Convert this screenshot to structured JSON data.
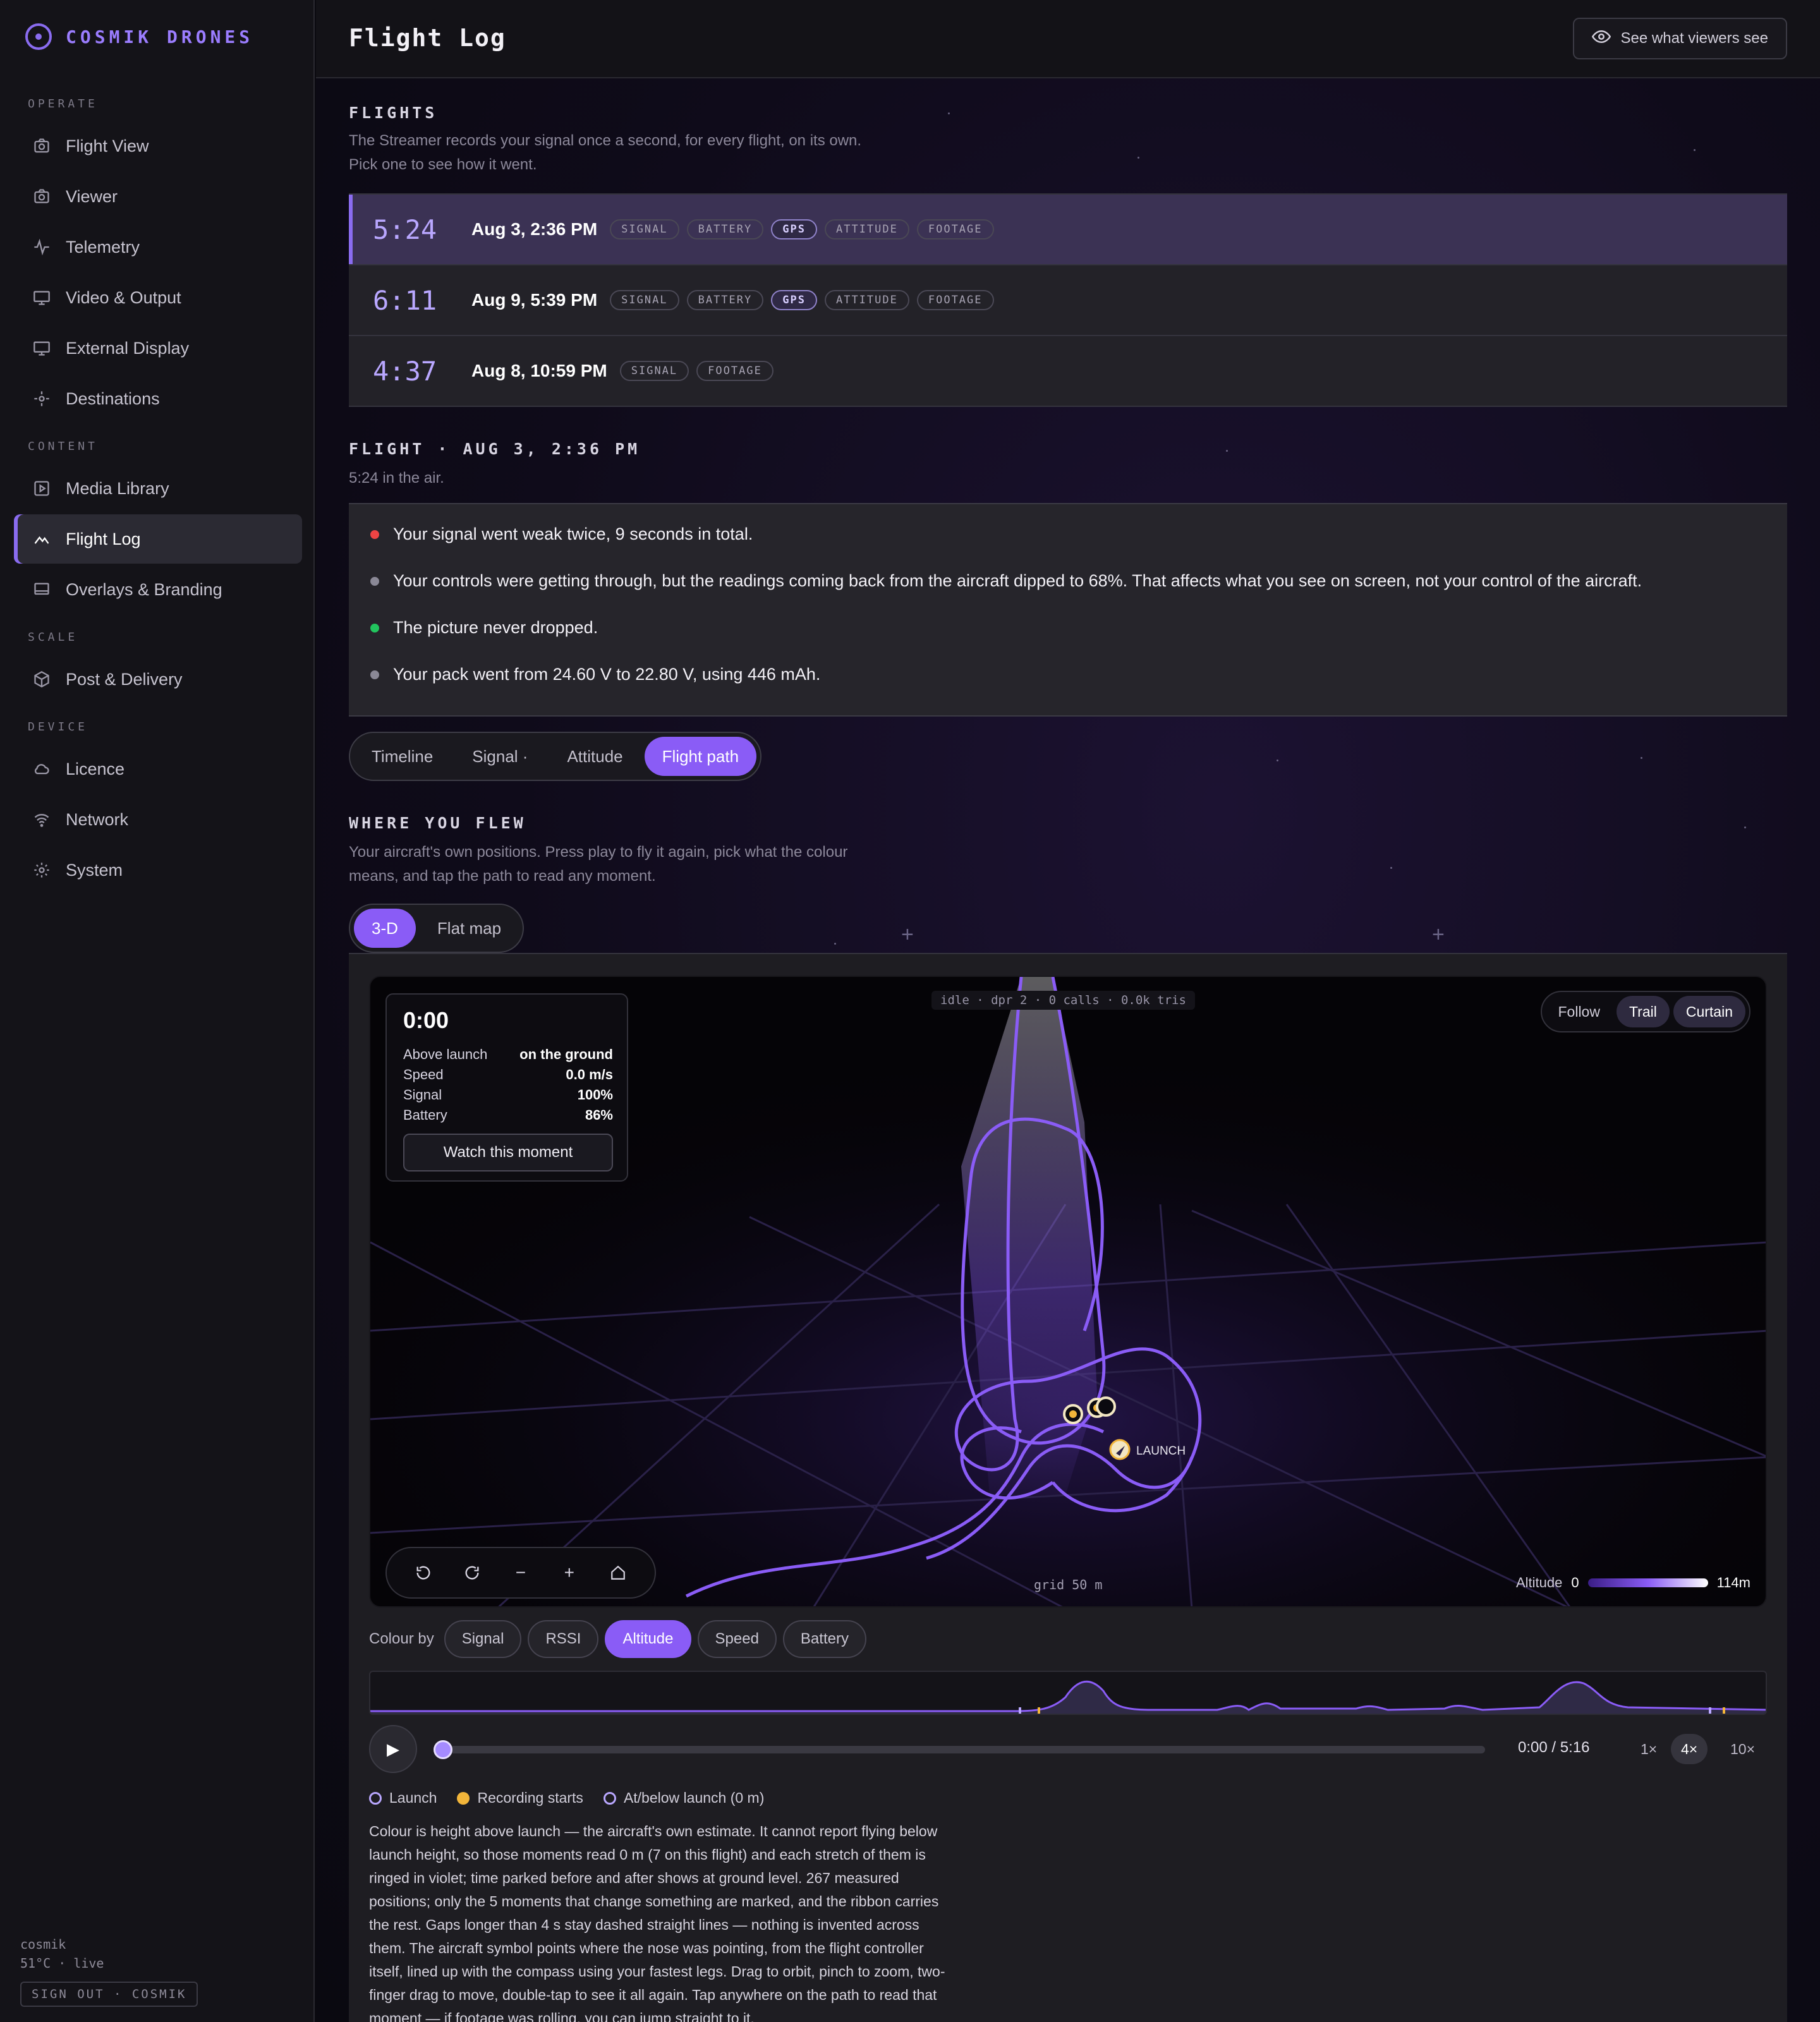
{
  "brand": {
    "name": "COSMIK DRONES"
  },
  "sidebar": {
    "sections": [
      {
        "title": "OPERATE",
        "items": [
          {
            "label": "Flight View",
            "icon": "camera-icon"
          },
          {
            "label": "Viewer",
            "icon": "camera-icon"
          },
          {
            "label": "Telemetry",
            "icon": "pulse-icon"
          },
          {
            "label": "Video & Output",
            "icon": "monitor-icon"
          },
          {
            "label": "External Display",
            "icon": "monitor-icon"
          },
          {
            "label": "Destinations",
            "icon": "target-icon"
          }
        ]
      },
      {
        "title": "CONTENT",
        "items": [
          {
            "label": "Media Library",
            "icon": "play-square-icon"
          },
          {
            "label": "Flight Log",
            "icon": "chart-icon",
            "active": true
          },
          {
            "label": "Overlays & Branding",
            "icon": "monitor-icon"
          }
        ]
      },
      {
        "title": "SCALE",
        "items": [
          {
            "label": "Post & Delivery",
            "icon": "box-icon"
          }
        ]
      },
      {
        "title": "DEVICE",
        "items": [
          {
            "label": "Licence",
            "icon": "cloud-icon"
          },
          {
            "label": "Network",
            "icon": "wifi-icon"
          },
          {
            "label": "System",
            "icon": "gear-icon"
          }
        ]
      }
    ],
    "footer": {
      "user": "cosmik",
      "status": "51°C · live",
      "signout": "SIGN OUT · COSMIK"
    }
  },
  "header": {
    "title": "Flight Log",
    "viewers_button": "See what viewers see"
  },
  "flights": {
    "title": "FLIGHTS",
    "subtitle_1": "The Streamer records your signal once a second, for every flight, on its own.",
    "subtitle_2": "Pick one to see how it went.",
    "rows": [
      {
        "duration": "5:24",
        "date": "Aug 3, 2:36 PM",
        "chips": [
          "SIGNAL",
          "BATTERY",
          "GPS",
          "ATTITUDE",
          "FOOTAGE"
        ],
        "selected": true
      },
      {
        "duration": "6:11",
        "date": "Aug 9, 5:39 PM",
        "chips": [
          "SIGNAL",
          "BATTERY",
          "GPS",
          "ATTITUDE",
          "FOOTAGE"
        ]
      },
      {
        "duration": "4:37",
        "date": "Aug 8, 10:59 PM",
        "chips": [
          "SIGNAL",
          "FOOTAGE"
        ]
      }
    ]
  },
  "flight_detail": {
    "title": "FLIGHT · AUG 3, 2:36 PM",
    "subtitle": "5:24 in the air.",
    "summary": [
      {
        "text": "Your signal went weak twice, 9 seconds in total.",
        "color": "#ef4444"
      },
      {
        "text": "Your controls were getting through, but the readings coming back from the aircraft dipped to 68%. That affects what you see on screen, not your control of the aircraft.",
        "color": "#8a8896"
      },
      {
        "text": "The picture never dropped.",
        "color": "#22c55e"
      },
      {
        "text": "Your pack went from 24.60 V to 22.80 V, using 446 mAh.",
        "color": "#8a8896"
      }
    ]
  },
  "tabs": [
    "Timeline",
    "Signal ·",
    "Attitude",
    "Flight path"
  ],
  "where": {
    "title": "WHERE YOU FLEW",
    "subtitle_1": "Your aircraft's own positions. Press play to fly it again, pick what the colour",
    "subtitle_2": "means, and tap the path to read any moment.",
    "view_modes": [
      "3-D",
      "Flat map"
    ]
  },
  "viewport": {
    "hud": {
      "time": "0:00",
      "rows": [
        {
          "label": "Above launch",
          "value": "on the ground"
        },
        {
          "label": "Speed",
          "value": "0.0 m/s"
        },
        {
          "label": "Signal",
          "value": "100%"
        },
        {
          "label": "Battery",
          "value": "86%"
        }
      ],
      "button": "Watch this moment"
    },
    "perf": "idle · dpr 2 · 0 calls · 0.0k tris",
    "modes": [
      "Follow",
      "Trail",
      "Curtain"
    ],
    "launch_label": "LAUNCH",
    "grid_label": "grid 50 m",
    "altitude": {
      "label": "Altitude",
      "min": "0",
      "max": "114m"
    }
  },
  "colour_by": {
    "label": "Colour by",
    "options": [
      "Signal",
      "RSSI",
      "Altitude",
      "Speed",
      "Battery"
    ],
    "selected": "Altitude"
  },
  "playback": {
    "time": "0:00 / 5:16",
    "speeds": [
      "1×",
      "4×",
      "10×"
    ],
    "selected_speed": "4×",
    "progress": 0
  },
  "legend": [
    "Launch",
    "Recording starts",
    "At/below launch (0 m)"
  ],
  "explanation": "Colour is height above launch — the aircraft's own estimate. It cannot report flying below launch height, so those moments read 0 m (7 on this flight) and each stretch of them is ringed in violet; time parked before and after shows at ground level. 267 measured positions; only the 5 moments that change something are marked, and the ribbon carries the rest. Gaps longer than 4 s stay dashed straight lines — nothing is invented across them. The aircraft symbol points where the nose was pointing, from the flight controller itself, lined up with the compass using your fastest legs. Drag to orbit, pinch to zoom, two-finger drag to move, double-tap to see it all again. Tap anywhere on the path to read that moment — if footage was rolling, you can jump straight to it.",
  "colors": {
    "accent": "#8a5cf6",
    "selected_row": "#3b3254",
    "trail": "#8a5cf6"
  }
}
